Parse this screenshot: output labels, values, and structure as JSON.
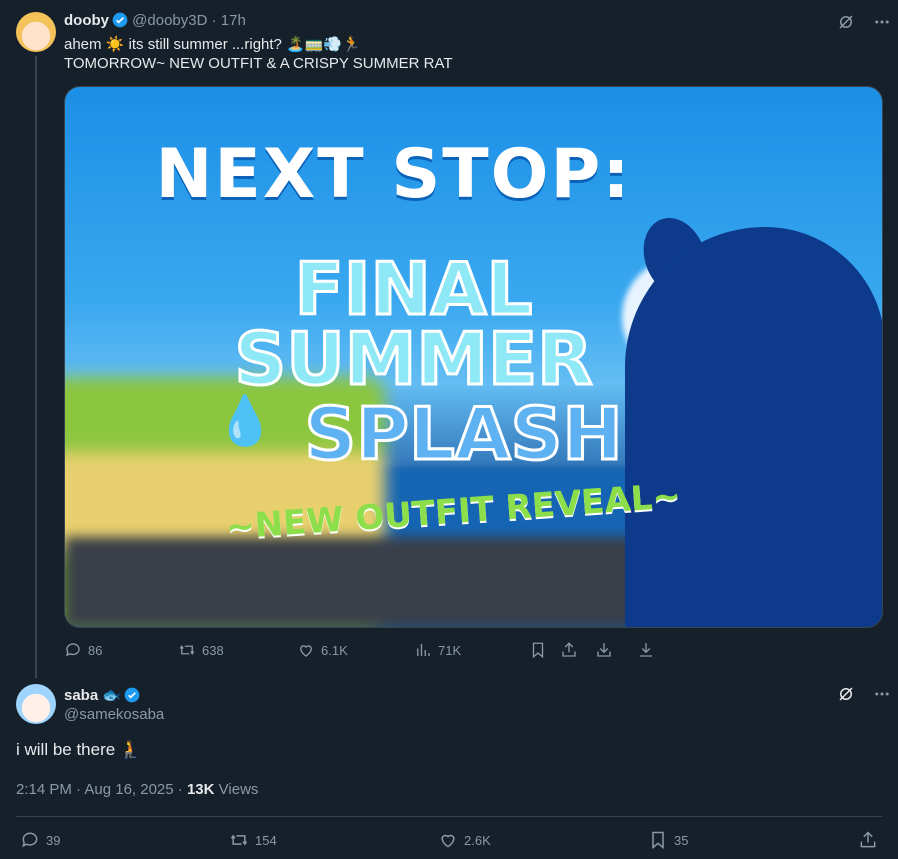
{
  "post1": {
    "display_name": "dooby",
    "handle": "@dooby3D",
    "separator": "·",
    "time": "17h",
    "text_line1": "ahem ☀️ its still summer ...right? 🏝️🚃💨🏃",
    "text_line2": "TOMORROW~ NEW OUTFIT & A CRISPY SUMMER RAT",
    "media": {
      "line1": "NEXT STOP:",
      "line2": "FINAL",
      "line3": "SUMMER",
      "line4": "SPLASH",
      "line5": "~NEW OUTFIT REVEAL~"
    },
    "stats": {
      "replies": "86",
      "reposts": "638",
      "likes": "6.1K",
      "views": "71K"
    }
  },
  "post2": {
    "display_name": "saba 🐟",
    "handle": "@samekosaba",
    "text": "i will be there 🧎",
    "timestamp": "2:14 PM · Aug 16, 2025",
    "separator": "·",
    "views_count": "13K",
    "views_label": "Views",
    "stats": {
      "replies": "39",
      "reposts": "154",
      "likes": "2.6K",
      "bookmarks": "35"
    }
  },
  "colors": {
    "background": "#15202b",
    "text": "#e7e9ea",
    "muted": "#8b98a5",
    "verified": "#1d9bf0",
    "border": "#38444d"
  }
}
